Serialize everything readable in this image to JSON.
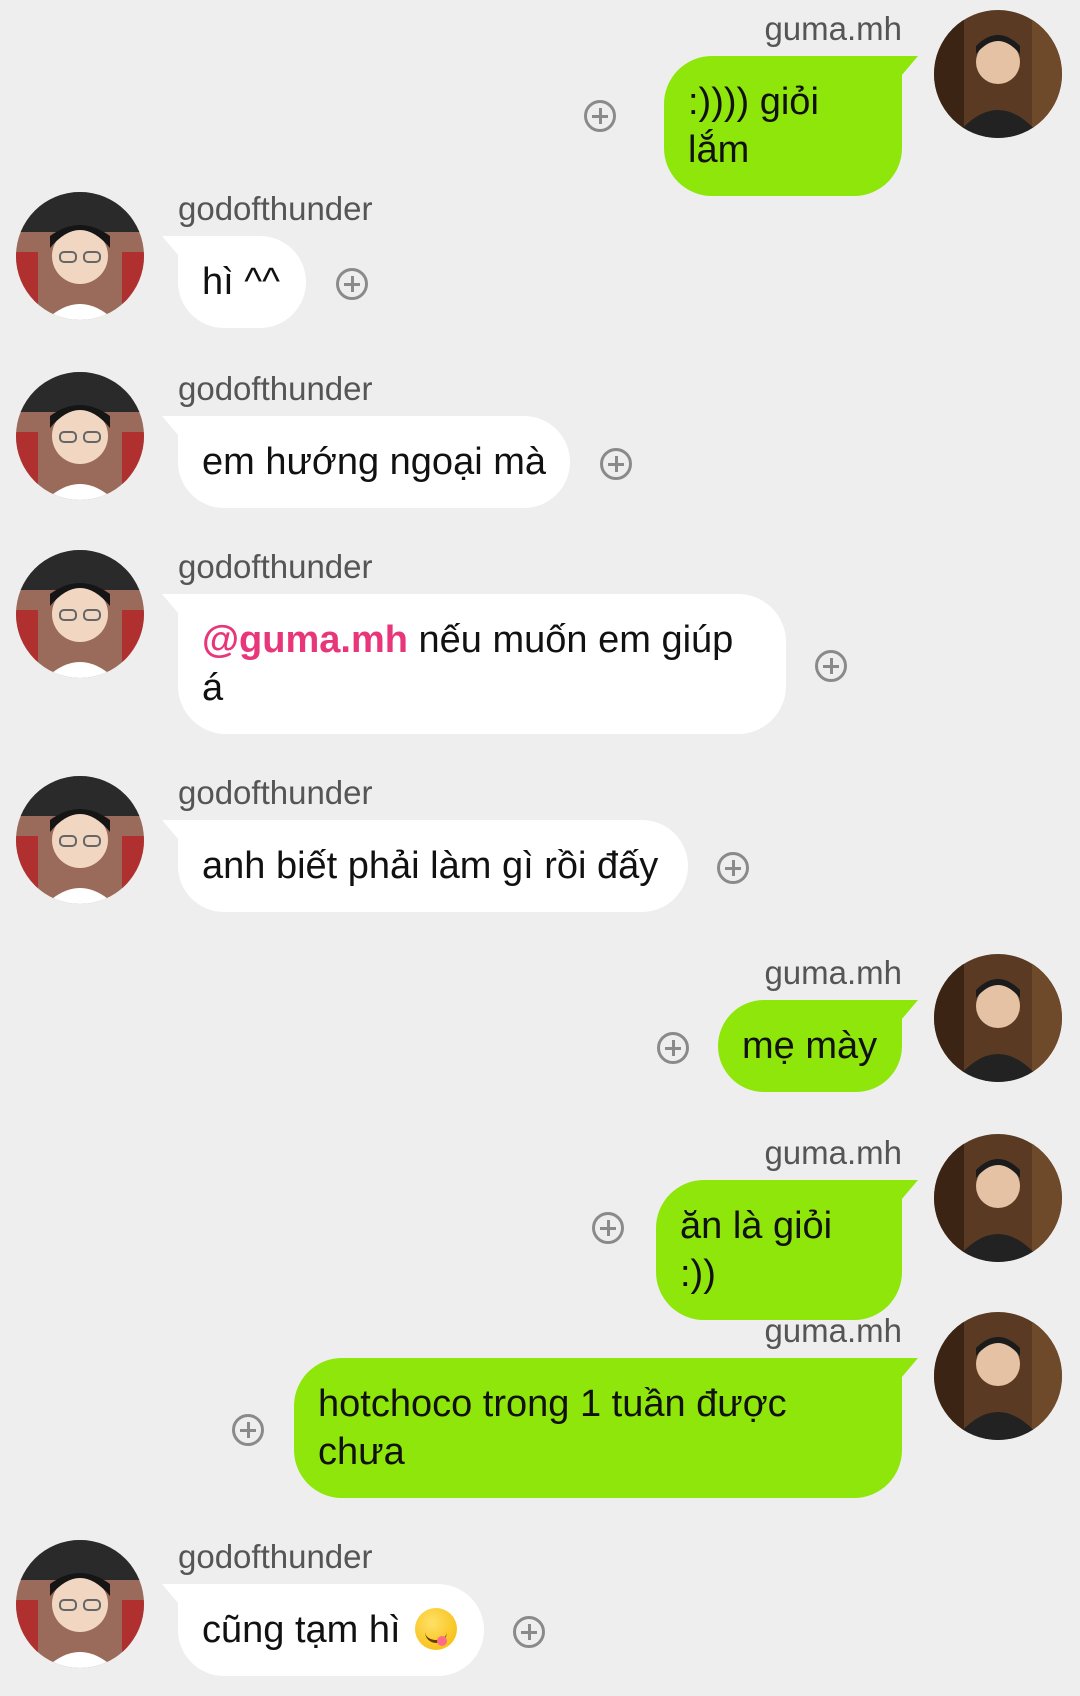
{
  "messages": [
    {
      "sender": "guma.mh",
      "side": "out",
      "text": ":)))) giỏi lắm"
    },
    {
      "sender": "godofthunder",
      "side": "in",
      "text": "hì ^^"
    },
    {
      "sender": "godofthunder",
      "side": "in",
      "text": "em hướng ngoại mà"
    },
    {
      "sender": "godofthunder",
      "side": "in",
      "mention": "@guma.mh",
      "text": " nếu muốn em giúp á"
    },
    {
      "sender": "godofthunder",
      "side": "in",
      "text": "anh biết phải làm gì rồi đấy"
    },
    {
      "sender": "guma.mh",
      "side": "out",
      "text": "mẹ mày"
    },
    {
      "sender": "guma.mh",
      "side": "out",
      "text": "ăn là giỏi :))"
    },
    {
      "sender": "guma.mh",
      "side": "out",
      "text": "hotchoco trong 1 tuần được chưa"
    },
    {
      "sender": "godofthunder",
      "side": "in",
      "text": "cũng tạm hì",
      "emoji": "yum-face-emoji"
    }
  ],
  "colors": {
    "background": "#eeeeee",
    "outgoing_bubble": "#8ee60a",
    "incoming_bubble": "#ffffff",
    "mention": "#e8367a",
    "sender_name": "#555555",
    "react_icon": "#8a8a8a"
  },
  "icons": {
    "react": "add-reaction-icon",
    "avatar_out": "avatar-guma",
    "avatar_in": "avatar-godofthunder"
  }
}
